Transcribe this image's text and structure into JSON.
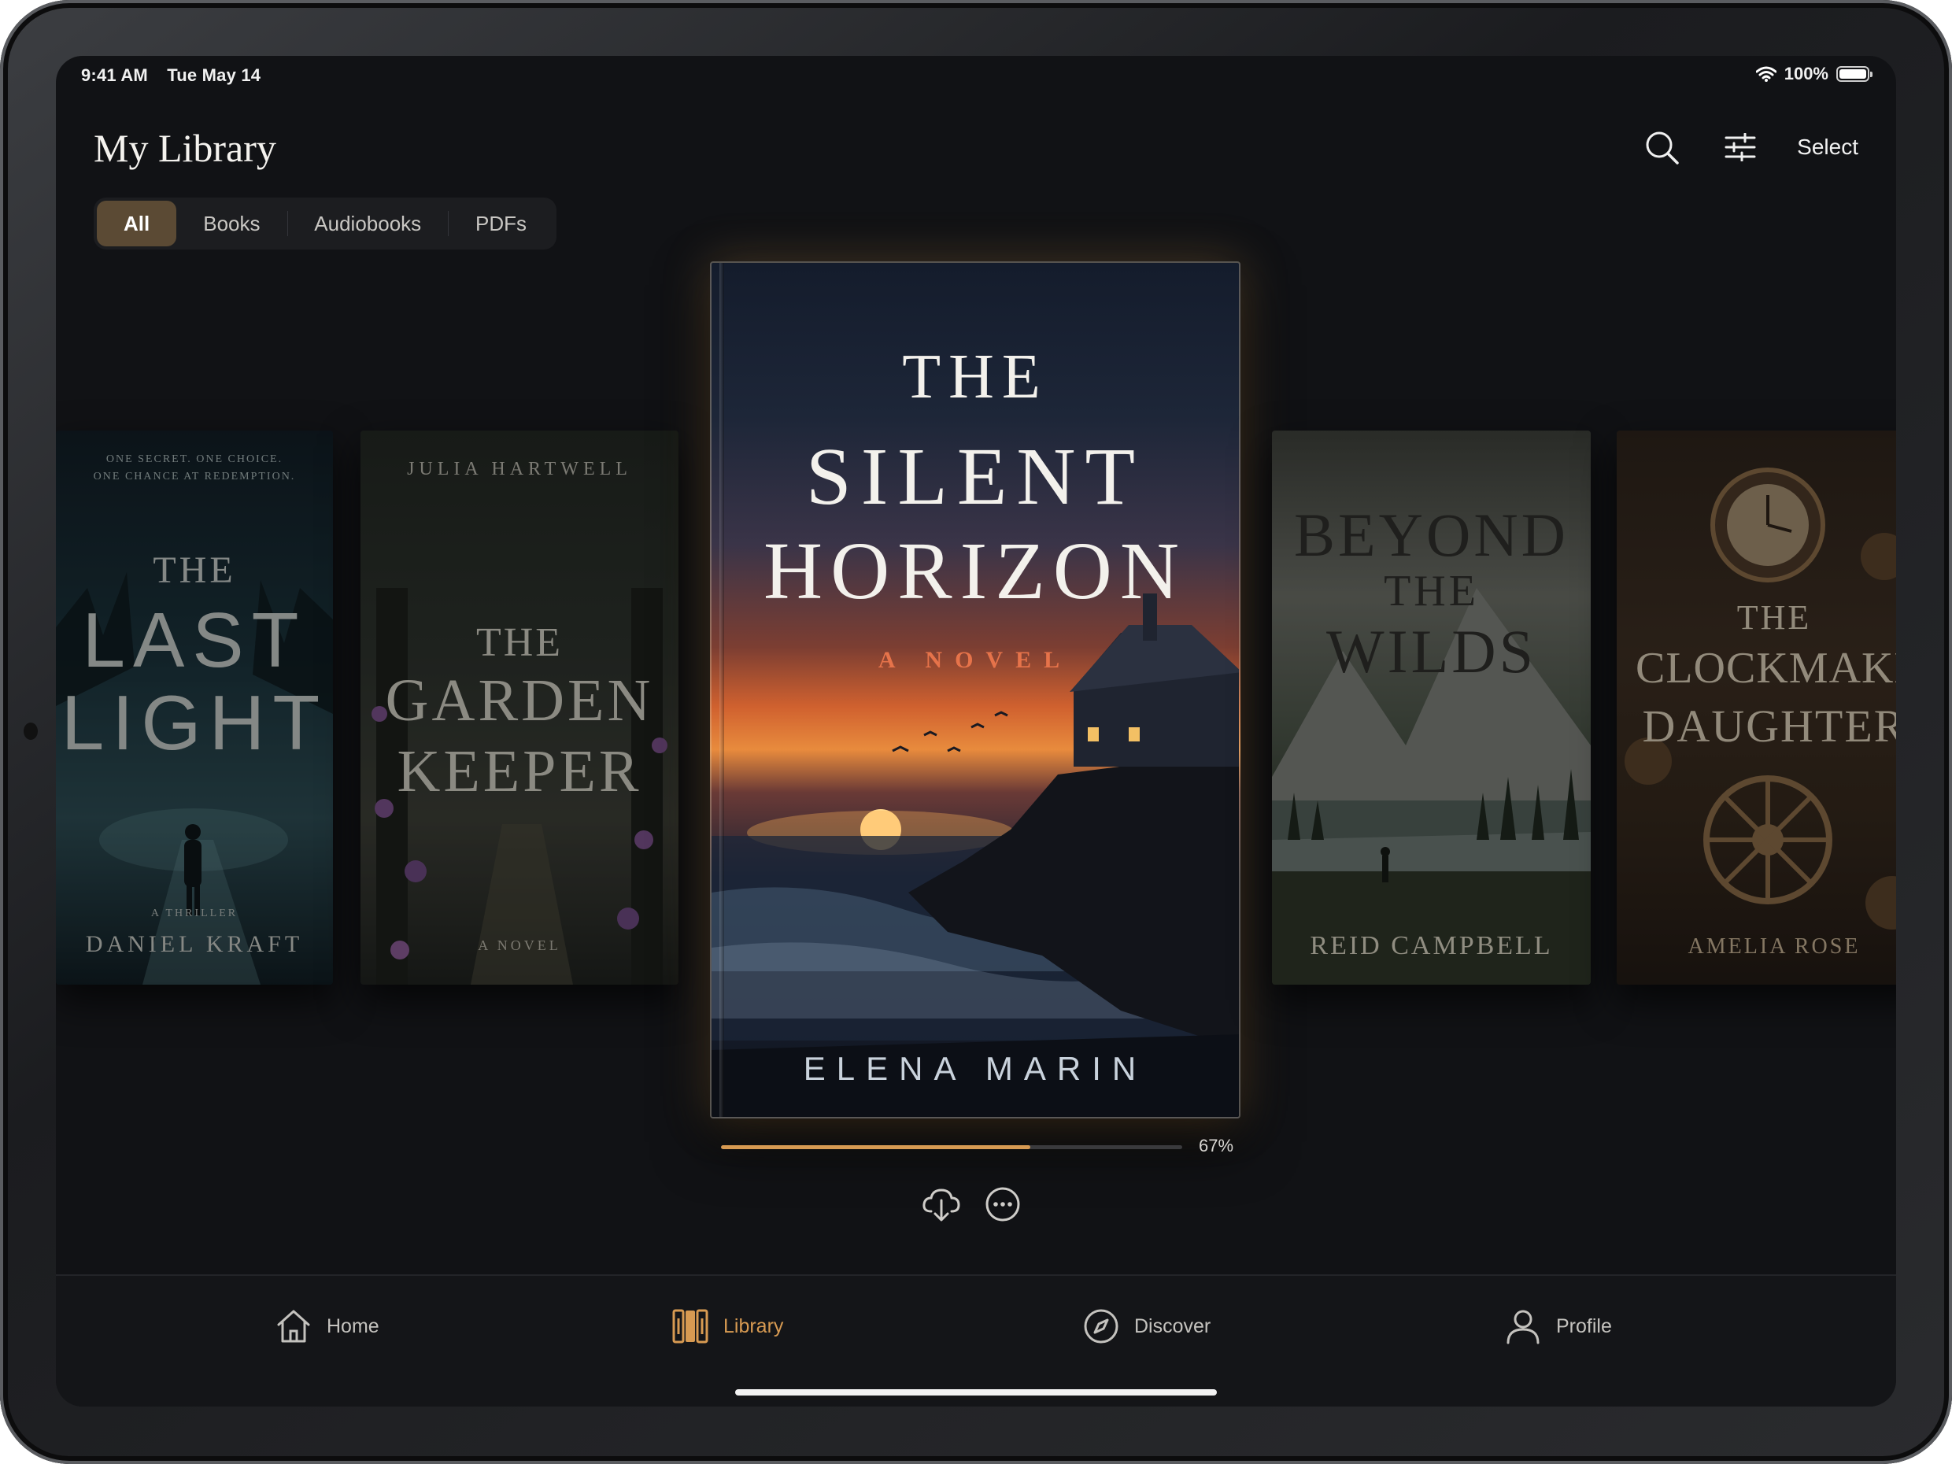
{
  "status_bar": {
    "time": "9:41 AM",
    "date": "Tue May 14",
    "battery": "100%"
  },
  "header": {
    "title": "My Library",
    "actions": {
      "search_icon": "search-icon",
      "filter_icon": "sliders-icon",
      "select_label": "Select"
    }
  },
  "filters": {
    "selected": "All",
    "items": [
      {
        "label": "All"
      },
      {
        "label": "Books"
      },
      {
        "label": "Audiobooks"
      },
      {
        "label": "PDFs"
      }
    ]
  },
  "books": [
    {
      "tagline_1": "ONE SECRET. ONE CHOICE.",
      "tagline_2": "ONE CHANCE AT REDEMPTION.",
      "title_1": "THE",
      "title_2": "LAST",
      "title_3": "LIGHT",
      "subtitle": "A THRILLER",
      "author": "DANIEL KRAFT"
    },
    {
      "author": "JULIA HARTWELL",
      "title_1": "THE",
      "title_2": "GARDEN",
      "title_3": "KEEPER",
      "subtitle": "A NOVEL"
    },
    {
      "title_1": "THE",
      "title_2": "SILENT",
      "title_3": "HORIZON",
      "subtitle": "A NOVEL",
      "author": "ELENA MARIN",
      "progress": 0.67,
      "progress_label": "67%"
    },
    {
      "title_1": "BEYOND",
      "title_2": "THE",
      "title_3": "WILDS",
      "author": "REID CAMPBELL"
    },
    {
      "title_1": "THE",
      "title_2": "CLOCKMAKER'S",
      "title_3": "DAUGHTER",
      "author": "AMELIA ROSE"
    }
  ],
  "book_actions": {
    "download_icon": "cloud-download-icon",
    "more_icon": "ellipsis-circle-icon"
  },
  "tabbar": {
    "items": [
      {
        "label": "Home",
        "icon": "house-icon"
      },
      {
        "label": "Library",
        "icon": "library-icon"
      },
      {
        "label": "Discover",
        "icon": "compass-icon"
      },
      {
        "label": "Profile",
        "icon": "person-icon"
      }
    ],
    "active": "Library"
  },
  "colors": {
    "accent": "#d79a52",
    "background": "#111215",
    "segment_active": "#5b4a34"
  }
}
